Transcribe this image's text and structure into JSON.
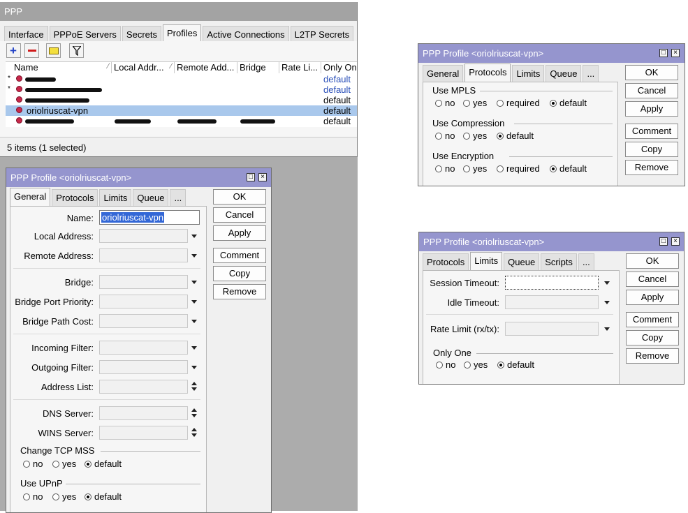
{
  "ppp_window": {
    "title": "PPP",
    "tabs": [
      "Interface",
      "PPPoE Servers",
      "Secrets",
      "Profiles",
      "Active Connections",
      "L2TP Secrets"
    ],
    "columns": [
      "Name",
      "Local Addr...",
      "Remote Add...",
      "Bridge",
      "Rate Li...",
      "Only One"
    ],
    "rows": [
      {
        "marker": "*",
        "only_one": "default",
        "color": "#2a4fb8",
        "selected": false
      },
      {
        "marker": "*",
        "only_one": "default",
        "color": "#2a4fb8",
        "selected": false
      },
      {
        "marker": "",
        "only_one": "default",
        "color": "#000000",
        "selected": false
      },
      {
        "marker": "",
        "name": "oriolriuscat-vpn",
        "only_one": "default",
        "color": "#000000",
        "selected": true
      },
      {
        "marker": "",
        "only_one": "default",
        "color": "#000000",
        "selected": false
      }
    ],
    "status": "5 items (1 selected)"
  },
  "dialog_general": {
    "title": "PPP Profile <oriolriuscat-vpn>",
    "tabs": [
      "General",
      "Protocols",
      "Limits",
      "Queue",
      "..."
    ],
    "buttons": [
      "OK",
      "Cancel",
      "Apply",
      "Comment",
      "Copy",
      "Remove"
    ],
    "name_label": "Name:",
    "name_value": "oriolriuscat-vpn",
    "fields": [
      "Local Address:",
      "Remote Address:",
      "Bridge:",
      "Bridge Port Priority:",
      "Bridge Path Cost:",
      "Incoming Filter:",
      "Outgoing Filter:",
      "Address List:",
      "DNS Server:",
      "WINS Server:"
    ],
    "tcp_mss": {
      "label": "Change TCP MSS",
      "options": [
        "no",
        "yes",
        "default"
      ],
      "selected": "default"
    },
    "upnp": {
      "label": "Use UPnP",
      "options": [
        "no",
        "yes",
        "default"
      ],
      "selected": "default"
    }
  },
  "dialog_protocols": {
    "title": "PPP Profile <oriolriuscat-vpn>",
    "tabs": [
      "General",
      "Protocols",
      "Limits",
      "Queue",
      "..."
    ],
    "buttons": [
      "OK",
      "Cancel",
      "Apply",
      "Comment",
      "Copy",
      "Remove"
    ],
    "mpls": {
      "label": "Use MPLS",
      "options": [
        "no",
        "yes",
        "required",
        "default"
      ],
      "selected": "default"
    },
    "compression": {
      "label": "Use Compression",
      "options": [
        "no",
        "yes",
        "default"
      ],
      "selected": "default"
    },
    "encryption": {
      "label": "Use Encryption",
      "options": [
        "no",
        "yes",
        "required",
        "default"
      ],
      "selected": "default"
    }
  },
  "dialog_limits": {
    "title": "PPP Profile <oriolriuscat-vpn>",
    "tabs": [
      "Protocols",
      "Limits",
      "Queue",
      "Scripts",
      "..."
    ],
    "buttons": [
      "OK",
      "Cancel",
      "Apply",
      "Comment",
      "Copy",
      "Remove"
    ],
    "session_timeout": "Session Timeout:",
    "idle_timeout": "Idle Timeout:",
    "rate_limit": "Rate Limit (rx/tx):",
    "only_one": {
      "label": "Only One",
      "options": [
        "no",
        "yes",
        "default"
      ],
      "selected": "default"
    }
  },
  "colors": {
    "title_active": "#9595ce",
    "title_inactive": "#a3a3a3",
    "selection": "#a9c8ec",
    "link_blue": "#2a4fb8"
  },
  "icons": [
    "add-icon",
    "remove-icon",
    "comment-icon",
    "filter-icon",
    "dropdown-arrow-icon",
    "spinner-icon",
    "minimize-icon",
    "close-icon"
  ]
}
